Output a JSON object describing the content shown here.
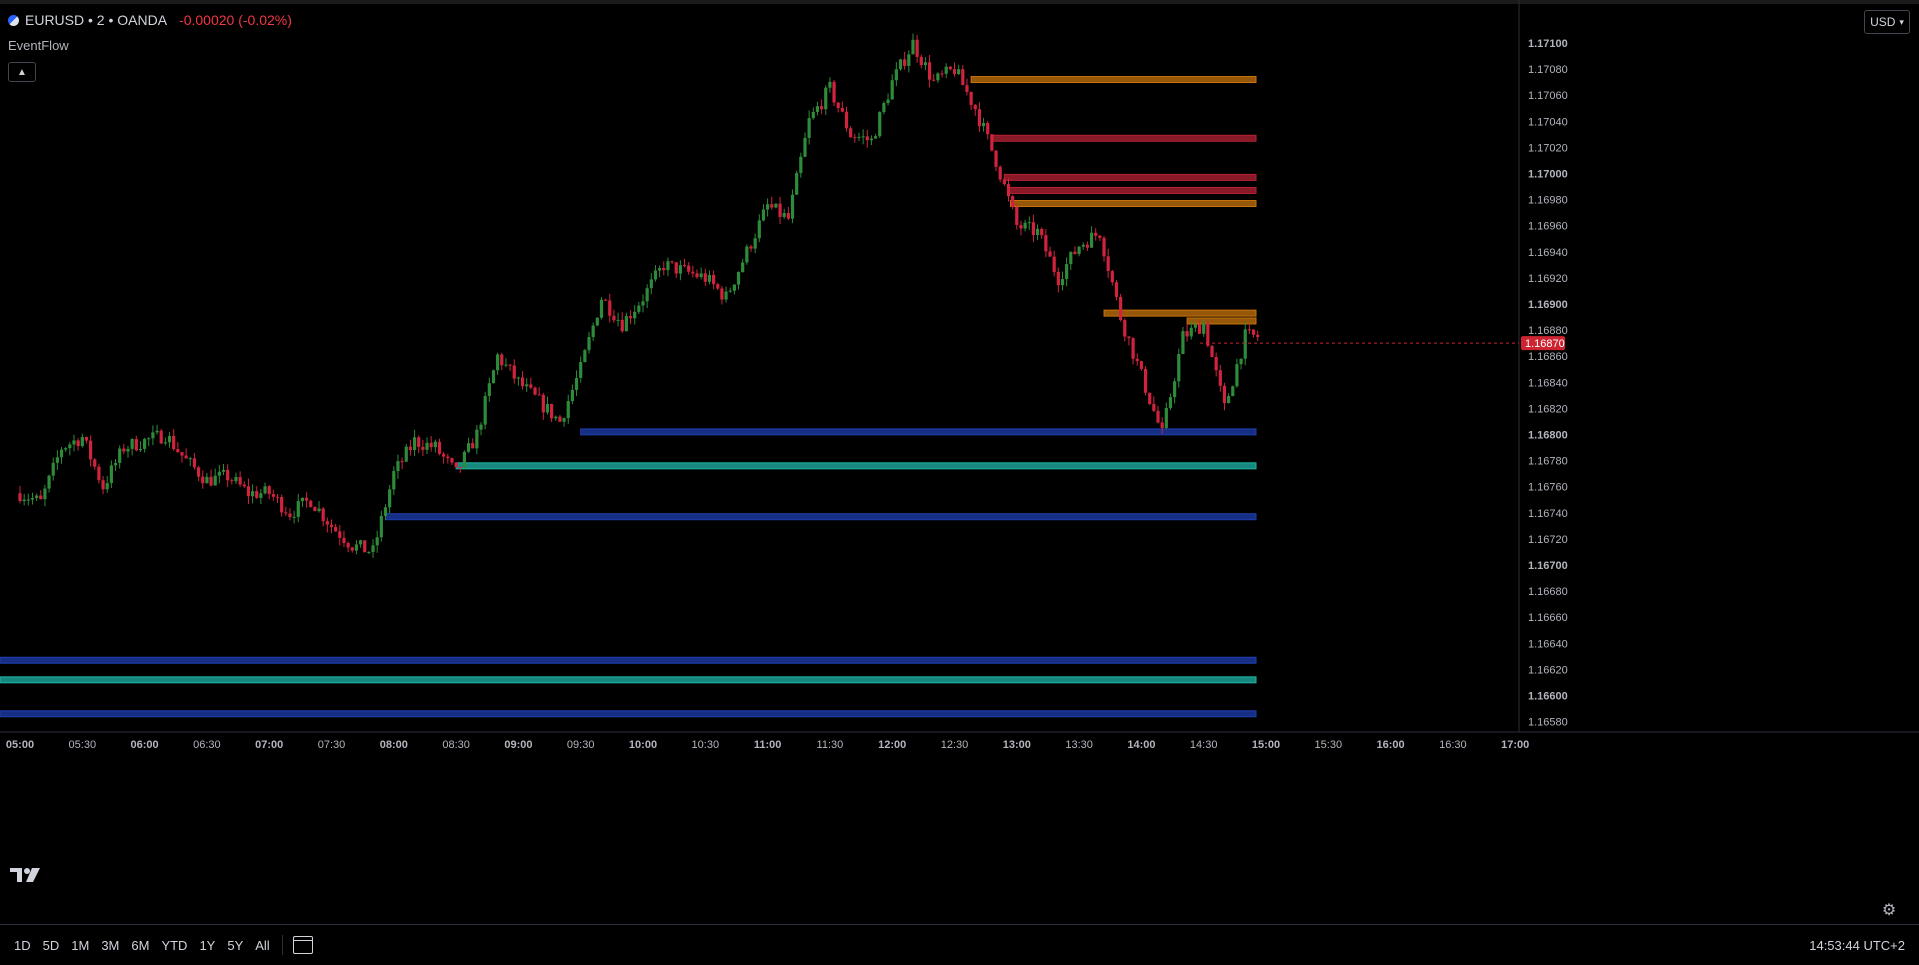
{
  "header": {
    "symbol": "EURUSD • 2 • OANDA",
    "change": "-0.00020 (-0.02%)",
    "indicator_name": "EventFlow",
    "currency": "USD"
  },
  "colors": {
    "background": "#000000",
    "up": "#26a69a",
    "candle_up": "#2e8b3a",
    "candle_down": "#d0243e",
    "price_tag": "#cc2430",
    "zone_blue": "#1e3fb0",
    "zone_teal": "#1fb5a8",
    "zone_orange": "#c8740c",
    "zone_red": "#b52234"
  },
  "price_axis": {
    "labels": [
      "1.17100",
      "1.17080",
      "1.17060",
      "1.17040",
      "1.17020",
      "1.17000",
      "1.16980",
      "1.16960",
      "1.16940",
      "1.16920",
      "1.16900",
      "1.16880",
      "1.16860",
      "1.16840",
      "1.16820",
      "1.16800",
      "1.16780",
      "1.16760",
      "1.16740",
      "1.16720",
      "1.16700",
      "1.16680",
      "1.16660",
      "1.16640",
      "1.16620",
      "1.16600",
      "1.16580"
    ],
    "bold": [
      "1.17100",
      "1.17000",
      "1.16900",
      "1.16800",
      "1.16700",
      "1.16600"
    ],
    "current_price": "1.16870"
  },
  "time_axis": {
    "labels": [
      "05:00",
      "05:30",
      "06:00",
      "06:30",
      "07:00",
      "07:30",
      "08:00",
      "08:30",
      "09:00",
      "09:30",
      "10:00",
      "10:30",
      "11:00",
      "11:30",
      "12:00",
      "12:30",
      "13:00",
      "13:30",
      "14:00",
      "14:30",
      "15:00",
      "15:30",
      "16:00",
      "16:30",
      "17:00"
    ],
    "bold": [
      "05:00",
      "06:00",
      "07:00",
      "08:00",
      "09:00",
      "10:00",
      "11:00",
      "12:00",
      "13:00",
      "14:00",
      "15:00",
      "16:00",
      "17:00"
    ]
  },
  "chart_data": {
    "type": "candlestick",
    "ylim": [
      1.16575,
      1.17115
    ],
    "x_start": "05:00",
    "bar_minutes": 2,
    "anchors": [
      [
        "05:00",
        1.16755
      ],
      [
        "05:10",
        1.16748
      ],
      [
        "05:20",
        1.1679
      ],
      [
        "05:30",
        1.16798
      ],
      [
        "05:40",
        1.1676
      ],
      [
        "05:50",
        1.1679
      ],
      [
        "06:00",
        1.16795
      ],
      [
        "06:10",
        1.168
      ],
      [
        "06:20",
        1.1678
      ],
      [
        "06:30",
        1.16765
      ],
      [
        "06:40",
        1.16768
      ],
      [
        "06:50",
        1.16755
      ],
      [
        "07:00",
        1.16755
      ],
      [
        "07:10",
        1.1674
      ],
      [
        "07:20",
        1.1675
      ],
      [
        "07:30",
        1.1673
      ],
      [
        "07:40",
        1.16715
      ],
      [
        "07:50",
        1.1671
      ],
      [
        "08:00",
        1.1677
      ],
      [
        "08:10",
        1.16795
      ],
      [
        "08:20",
        1.1679
      ],
      [
        "08:30",
        1.1677
      ],
      [
        "08:40",
        1.168
      ],
      [
        "08:50",
        1.1686
      ],
      [
        "09:00",
        1.1684
      ],
      [
        "09:10",
        1.16825
      ],
      [
        "09:20",
        1.1681
      ],
      [
        "09:30",
        1.1685
      ],
      [
        "09:40",
        1.16905
      ],
      [
        "09:50",
        1.16885
      ],
      [
        "10:00",
        1.16905
      ],
      [
        "10:10",
        1.1693
      ],
      [
        "10:20",
        1.16925
      ],
      [
        "10:30",
        1.1692
      ],
      [
        "10:40",
        1.16905
      ],
      [
        "10:50",
        1.1694
      ],
      [
        "11:00",
        1.16975
      ],
      [
        "11:10",
        1.16965
      ],
      [
        "11:20",
        1.1704
      ],
      [
        "11:30",
        1.17065
      ],
      [
        "11:40",
        1.1703
      ],
      [
        "11:50",
        1.17025
      ],
      [
        "12:00",
        1.1707
      ],
      [
        "12:10",
        1.171
      ],
      [
        "12:20",
        1.1707
      ],
      [
        "12:30",
        1.1708
      ],
      [
        "12:40",
        1.1705
      ],
      [
        "12:50",
        1.1701
      ],
      [
        "13:00",
        1.1696
      ],
      [
        "13:10",
        1.16955
      ],
      [
        "13:20",
        1.1692
      ],
      [
        "13:30",
        1.16945
      ],
      [
        "13:40",
        1.16955
      ],
      [
        "13:50",
        1.1689
      ],
      [
        "14:00",
        1.16845
      ],
      [
        "14:10",
        1.168
      ],
      [
        "14:20",
        1.16875
      ],
      [
        "14:30",
        1.16885
      ],
      [
        "14:40",
        1.1682
      ],
      [
        "14:50",
        1.16875
      ]
    ],
    "zones": [
      {
        "kind": "orange",
        "from": "12:38",
        "price": 1.17072
      },
      {
        "kind": "red",
        "from": "12:48",
        "price": 1.17027
      },
      {
        "kind": "red",
        "from": "12:54",
        "price": 1.16997
      },
      {
        "kind": "red",
        "from": "12:56",
        "price": 1.16987
      },
      {
        "kind": "orange",
        "from": "12:57",
        "price": 1.16977
      },
      {
        "kind": "orange",
        "from": "13:42",
        "price": 1.16893
      },
      {
        "kind": "orange",
        "from": "14:22",
        "price": 1.16887
      },
      {
        "kind": "blue",
        "from": "09:30",
        "price": 1.16802
      },
      {
        "kind": "teal",
        "from": "08:30",
        "price": 1.16776
      },
      {
        "kind": "blue",
        "from": "07:56",
        "price": 1.16737
      },
      {
        "kind": "blue",
        "from": "04:40",
        "price": 1.16627
      },
      {
        "kind": "teal",
        "from": "04:40",
        "price": 1.16612
      },
      {
        "kind": "blue",
        "from": "04:40",
        "price": 1.16586
      }
    ]
  },
  "bottom_bar": {
    "ranges": [
      "1D",
      "5D",
      "1M",
      "3M",
      "6M",
      "YTD",
      "1Y",
      "5Y",
      "All"
    ],
    "clock": "14:53:44 UTC+2"
  }
}
